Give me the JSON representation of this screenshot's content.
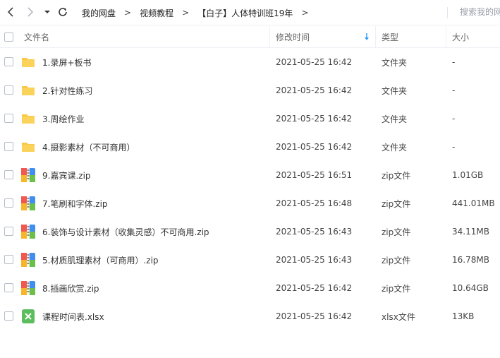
{
  "toolbar": {
    "breadcrumbs": [
      "我的网盘",
      "视频教程",
      "【白子】人体特训班19年"
    ],
    "separator": ">",
    "search_placeholder": "搜索我的网盘"
  },
  "header": {
    "name": "文件名",
    "modified": "修改时间",
    "type": "类型",
    "size": "大小"
  },
  "colors": {
    "folder": "#f9c846",
    "sort_arrow": "#2b9bf4",
    "xlsx": "#5bbd5e"
  },
  "files": [
    {
      "icon": "folder-icon",
      "name": "1.录屏+板书",
      "modified": "2021-05-25 16:42",
      "type": "文件夹",
      "size": "-"
    },
    {
      "icon": "folder-icon",
      "name": "2.针对性练习",
      "modified": "2021-05-25 16:42",
      "type": "文件夹",
      "size": "-"
    },
    {
      "icon": "folder-icon",
      "name": "3.周绘作业",
      "modified": "2021-05-25 16:42",
      "type": "文件夹",
      "size": "-"
    },
    {
      "icon": "folder-icon",
      "name": "4.摄影素材（不可商用）",
      "modified": "2021-05-25 16:42",
      "type": "文件夹",
      "size": "-"
    },
    {
      "icon": "zip-icon",
      "name": "9.嘉宾课.zip",
      "modified": "2021-05-25 16:51",
      "type": "zip文件",
      "size": "1.01GB"
    },
    {
      "icon": "zip-icon",
      "name": "7.笔刷和字体.zip",
      "modified": "2021-05-25 16:48",
      "type": "zip文件",
      "size": "441.01MB"
    },
    {
      "icon": "zip-icon",
      "name": "6.装饰与设计素材（收集灵感）不可商用.zip",
      "modified": "2021-05-25 16:43",
      "type": "zip文件",
      "size": "34.11MB"
    },
    {
      "icon": "zip-icon",
      "name": "5.材质肌理素材（可商用）.zip",
      "modified": "2021-05-25 16:43",
      "type": "zip文件",
      "size": "16.78MB"
    },
    {
      "icon": "zip-icon",
      "name": "8.插画欣赏.zip",
      "modified": "2021-05-25 16:42",
      "type": "zip文件",
      "size": "10.64GB"
    },
    {
      "icon": "xlsx-icon",
      "name": "课程时间表.xlsx",
      "modified": "2021-05-25 16:42",
      "type": "xlsx文件",
      "size": "13KB"
    }
  ]
}
